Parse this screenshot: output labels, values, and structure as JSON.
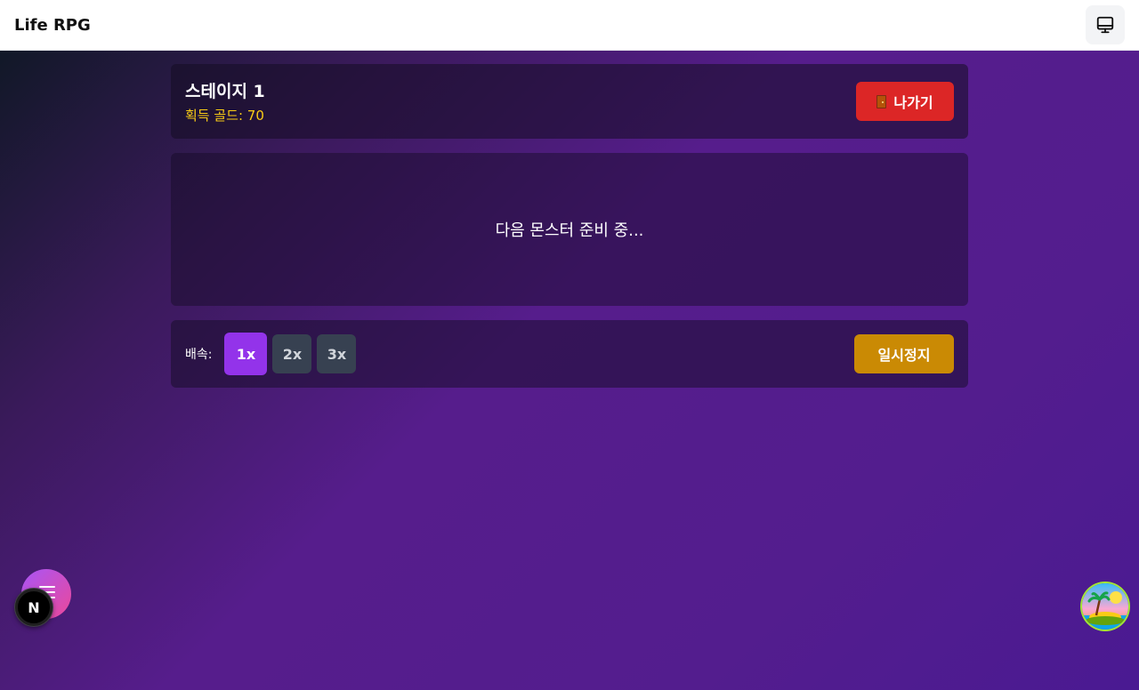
{
  "app": {
    "title": "Life RPG"
  },
  "stage": {
    "title": "스테이지 1",
    "gold_label": "획득 골드: 70",
    "exit_label": "나가기"
  },
  "battle": {
    "message": "다음 몬스터 준비 중..."
  },
  "controls": {
    "speed_label": "배속:",
    "speeds": [
      "1x",
      "2x",
      "3x"
    ],
    "active_speed": "1x",
    "pause_label": "일시정지"
  },
  "floating": {
    "next_badge": "N"
  },
  "colors": {
    "exit": "#dc2626",
    "pause": "#ca8a04",
    "speed_active": "#9333ea",
    "gold": "#facc15"
  },
  "icons": {
    "device": "monitor-icon",
    "exit": "door-icon",
    "menu": "menu-icon",
    "island": "island-icon"
  }
}
